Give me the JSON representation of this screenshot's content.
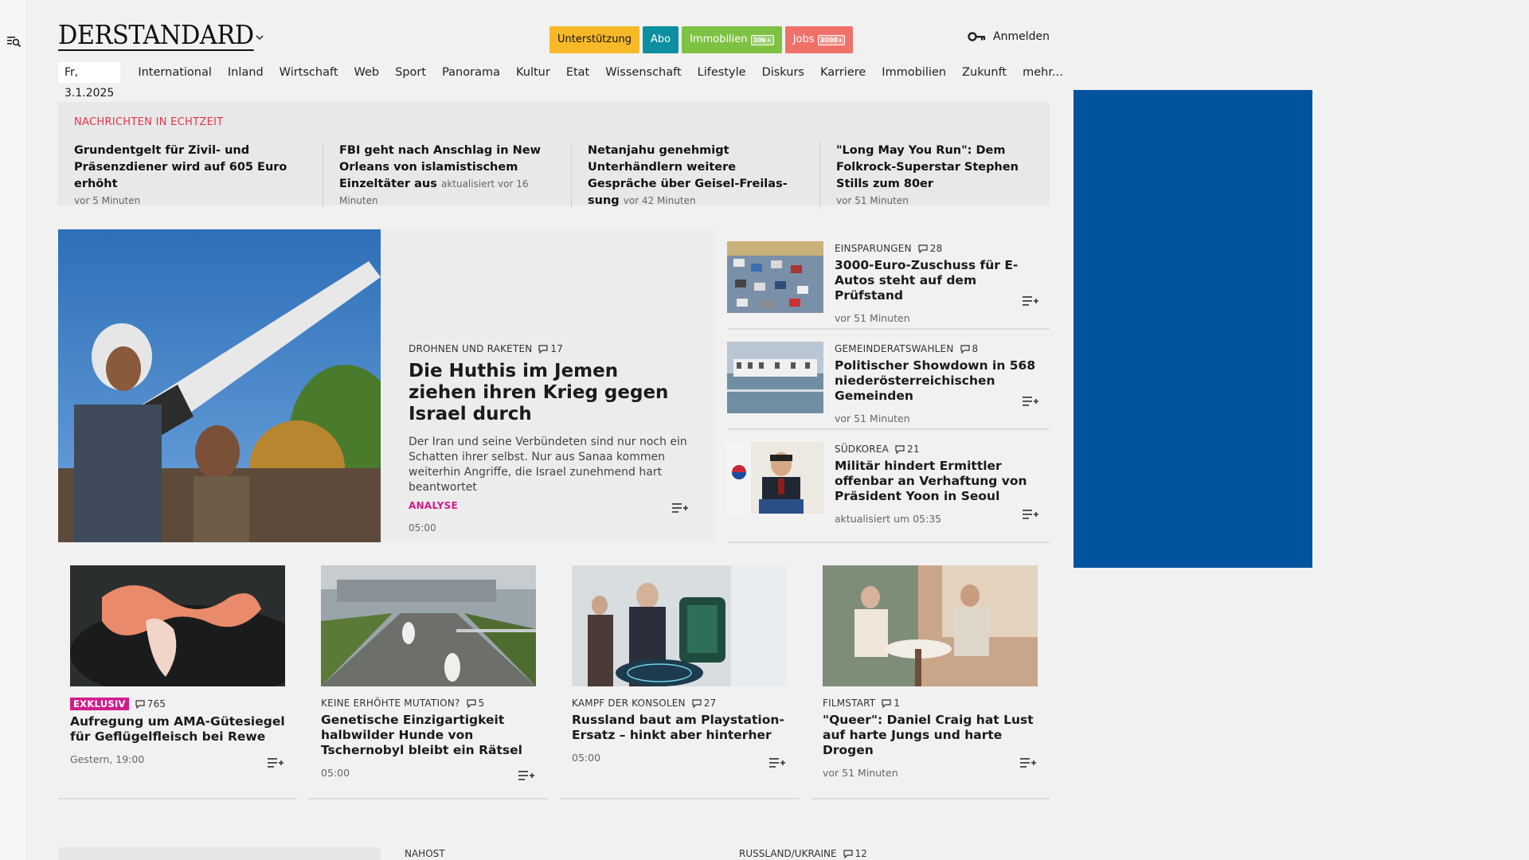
{
  "header": {
    "logo": "DERSTANDARD",
    "pills": [
      {
        "label": "Unterstützung",
        "badge": ""
      },
      {
        "label": "Abo",
        "badge": ""
      },
      {
        "label": "Immobilien",
        "badge": "30k+"
      },
      {
        "label": "Jobs",
        "badge": "3000+"
      }
    ],
    "login": "Anmelden"
  },
  "nav": {
    "date": "Fr, 3.1.2025",
    "items": [
      "International",
      "Inland",
      "Wirtschaft",
      "Web",
      "Sport",
      "Panorama",
      "Kultur",
      "Etat",
      "Wissenschaft",
      "Lifestyle",
      "Diskurs",
      "Karriere",
      "Immobilien",
      "Zukunft",
      "mehr..."
    ]
  },
  "ticker": {
    "title": "NACHRICHTEN IN ECHTZEIT",
    "items": [
      {
        "title": "Grundentgelt für Zivil- und Präsenz­diener wird auf 605 Euro erhöht",
        "time": "vor 5 Minuten"
      },
      {
        "title": "FBI geht nach Anschlag in New Or­leans von islamistischem Einzeltäter aus",
        "time": "aktualisiert vor 16 Minuten"
      },
      {
        "title": "Netanjahu genehmigt Unterhändlern weitere Gespräche über Geisel-Freilas­sung",
        "time": "vor 42 Minuten"
      },
      {
        "title": "\"Long May You Run\": Dem Folkrock-Superstar Stephen Stills zum 80er",
        "time": "vor 51 Minuten"
      }
    ]
  },
  "hero": {
    "kicker": "DROHNEN UND RAKETEN",
    "comments": "17",
    "title": "Die Huthis im Jemen ziehen ihren Krieg gegen Israel durch",
    "text": "Der Iran und seine Verbündeten sind nur noch ein Schatten ihrer selbst. Nur aus Sanaa kommen weiterhin Angriffe, die Israel zunehmend hart beantwortet",
    "tag": "ANALYSE",
    "time": "05:00"
  },
  "side": [
    {
      "kicker": "EINSPARUNGEN",
      "comments": "28",
      "title": "3000-Euro-Zuschuss für E-Autos steht auf dem Prüfstand",
      "time": "vor 51 Minuten"
    },
    {
      "kicker": "GEMEINDERATSWAHLEN",
      "comments": "8",
      "title": "Politischer Showdown in 568 nie­derösterreichischen Gemeinden",
      "time": "vor 51 Minuten"
    },
    {
      "kicker": "SÜDKOREA",
      "comments": "21",
      "title": "Militär hindert Ermittler offenbar an Verhaftung von Präsident Yoon in Seoul",
      "time": "aktualisiert um 05:35"
    }
  ],
  "cards": [
    {
      "kicker": "EXKLUSIV",
      "comments": "765",
      "title": "Aufregung um AMA-Gütesiegel für Geflügelfleisch bei Rewe",
      "time": "Gestern, 19:00"
    },
    {
      "kicker": "KEINE ERHÖHTE MUTATION?",
      "comments": "5",
      "title": "Genetische Einzigartigkeit halbwilder Hunde von Tschernobyl bleibt ein Rätsel",
      "time": "05:00"
    },
    {
      "kicker": "KAMPF DER KONSOLEN",
      "comments": "27",
      "title": "Russland baut am Playstation-Er­satz – hinkt aber hinterher",
      "time": "05:00"
    },
    {
      "kicker": "FILMSTART",
      "comments": "1",
      "title": "\"Queer\": Daniel Craig hat Lust auf harte Jungs und harte Drogen",
      "time": "vor 51 Minuten"
    }
  ],
  "bottom": {
    "kicker1": "NAHOST",
    "kicker2": "RUSSLAND/UKRAINE",
    "comments2": "12"
  },
  "colors": {
    "ticker_accent": "#e2344d",
    "analysis_tag": "#d11d8c",
    "ad_block": "#00539f"
  }
}
